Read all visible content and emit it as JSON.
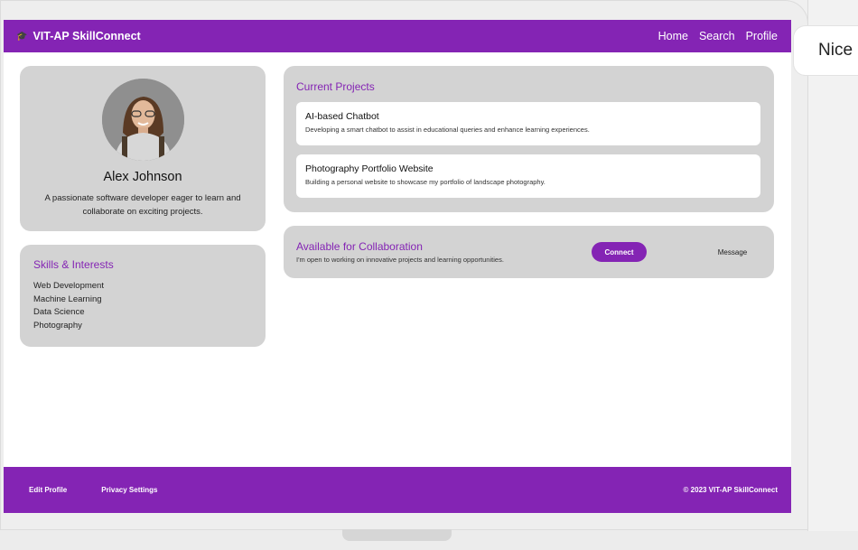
{
  "header": {
    "brand_icon": "🎓",
    "brand_name": "VIT-AP SkillConnect",
    "nav": [
      "Home",
      "Search",
      "Profile"
    ]
  },
  "profile": {
    "name": "Alex Johnson",
    "bio": "A passionate software developer eager to learn and collaborate on exciting projects."
  },
  "skills": {
    "title": "Skills & Interests",
    "items": [
      "Web Development",
      "Machine Learning",
      "Data Science",
      "Photography"
    ]
  },
  "projects": {
    "title": "Current Projects",
    "items": [
      {
        "title": "AI-based Chatbot",
        "desc": "Developing a smart chatbot to assist in educational queries and enhance learning experiences."
      },
      {
        "title": "Photography Portfolio Website",
        "desc": "Building a personal website to showcase my portfolio of landscape photography."
      }
    ]
  },
  "collaboration": {
    "title": "Available for Collaboration",
    "desc": "I'm open to working on innovative projects and learning opportunities.",
    "connect_label": "Connect",
    "message_label": "Message"
  },
  "footer": {
    "links": [
      "Edit Profile",
      "Privacy Settings"
    ],
    "copyright": "© 2023 VIT-AP SkillConnect"
  },
  "toast": {
    "text": "Nice"
  },
  "colors": {
    "accent": "#8424b4",
    "card": "#d3d3d3"
  }
}
